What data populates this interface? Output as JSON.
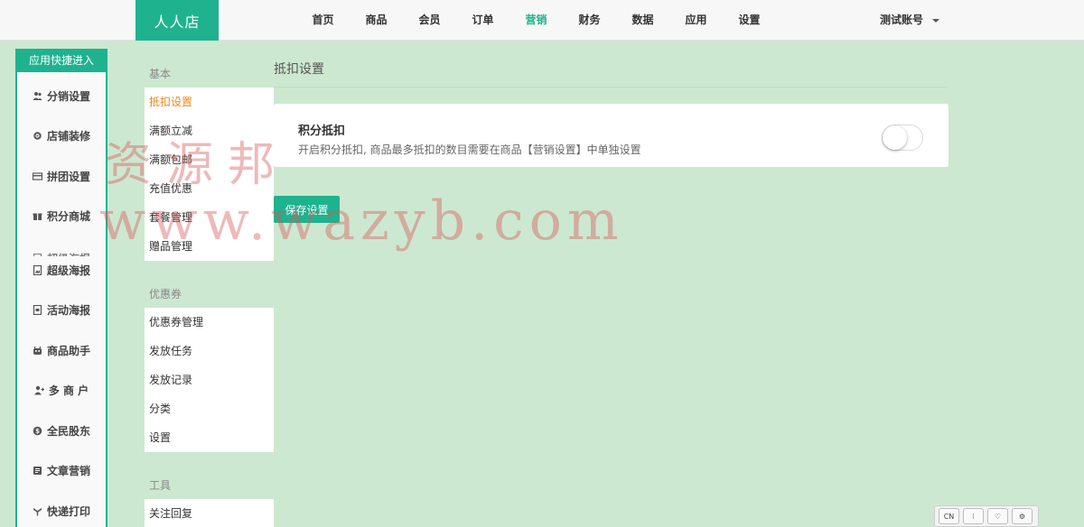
{
  "brand": {
    "logo_text": "人人店",
    "accent_color": "#1fb28f",
    "highlight_color": "#f0861e"
  },
  "nav": {
    "items": [
      "首页",
      "商品",
      "会员",
      "订单",
      "营销",
      "财务",
      "数据",
      "应用",
      "设置"
    ],
    "active_index": 4,
    "account": "测试账号"
  },
  "quick_panel": {
    "title": "应用快捷进入",
    "items": [
      {
        "label": "分销设置",
        "icon": "users-icon"
      },
      {
        "label": "店铺装修",
        "icon": "gear-icon"
      },
      {
        "label": "拼团设置",
        "icon": "card-icon"
      },
      {
        "label": "积分商城",
        "icon": "gift-icon"
      },
      {
        "label": "超级海报",
        "icon": "image-icon"
      },
      {
        "label": "活动海报",
        "icon": "image-icon"
      },
      {
        "label": "商品助手",
        "icon": "robot-icon"
      },
      {
        "label": "多 商 户",
        "icon": "user-plus-icon"
      },
      {
        "label": "全民股东",
        "icon": "coin-icon"
      },
      {
        "label": "文章营销",
        "icon": "doc-icon"
      },
      {
        "label": "快递打印",
        "icon": "printer-icon"
      }
    ]
  },
  "submenu": {
    "groups": [
      {
        "title": "基本",
        "items": [
          "抵扣设置",
          "满额立减",
          "满额包邮",
          "充值优惠",
          "套餐管理",
          "赠品管理"
        ],
        "active_index": 0
      },
      {
        "title": "优惠券",
        "items": [
          "优惠券管理",
          "发放任务",
          "发放记录",
          "分类",
          "设置"
        ]
      },
      {
        "title": "工具",
        "items": [
          "关注回复"
        ]
      }
    ]
  },
  "main": {
    "page_title": "抵扣设置",
    "card": {
      "title": "积分抵扣",
      "description": "开启积分抵扣, 商品最多抵扣的数目需要在商品【营销设置】中单独设置",
      "toggle_on": false
    },
    "save_label": "保存设置"
  },
  "watermark": {
    "text_cn": "资源邦",
    "text_url": "www.wazyb.com"
  },
  "toolbar": {
    "items": [
      "CN",
      "⁝",
      "♡",
      "⚙"
    ]
  }
}
